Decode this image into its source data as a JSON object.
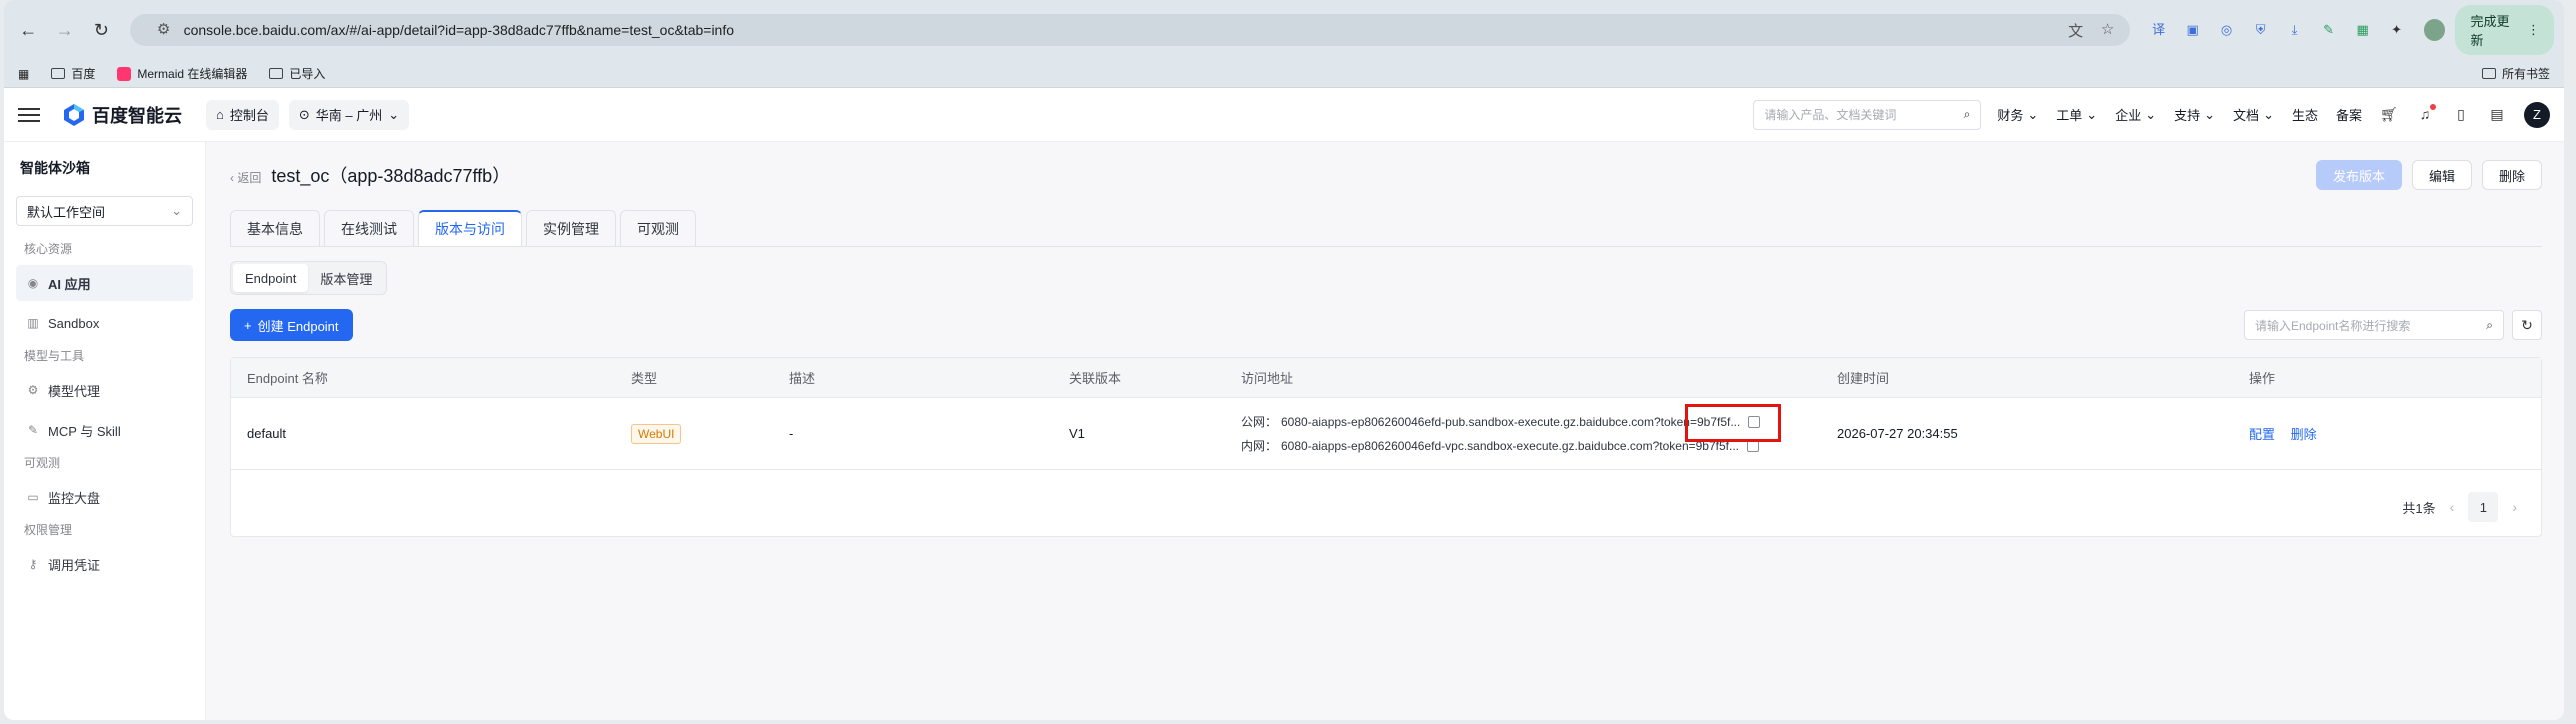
{
  "browser": {
    "url": "console.bce.baidu.com/ax/#/ai-app/detail?id=app-38d8adc77ffb&name=test_oc&tab=info",
    "update_label": "完成更新",
    "bookmarks": [
      "百度",
      "Mermaid 在线编辑器",
      "已导入"
    ],
    "all_bookmarks": "所有书签"
  },
  "topnav": {
    "brand": "百度智能云",
    "console": "控制台",
    "region": "华南 – 广州",
    "search_placeholder": "请输入产品、文档关键词",
    "menu": [
      "财务",
      "工单",
      "企业",
      "支持",
      "文档",
      "生态",
      "备案"
    ],
    "user_initial": "Z"
  },
  "sidebar": {
    "title": "智能体沙箱",
    "workspace": "默认工作空间",
    "groups": [
      {
        "label": "核心资源",
        "items": [
          "AI 应用",
          "Sandbox"
        ]
      },
      {
        "label": "模型与工具",
        "items": [
          "模型代理",
          "MCP 与 Skill"
        ]
      },
      {
        "label": "可观测",
        "items": [
          "监控大盘"
        ]
      },
      {
        "label": "权限管理",
        "items": [
          "调用凭证"
        ]
      }
    ]
  },
  "page": {
    "back": "返回",
    "title": "test_oc（app-38d8adc77ffb）",
    "actions": {
      "publish": "发布版本",
      "edit": "编辑",
      "delete": "删除"
    },
    "tabs": [
      "基本信息",
      "在线测试",
      "版本与访问",
      "实例管理",
      "可观测"
    ],
    "active_tab": "版本与访问",
    "segments": [
      "Endpoint",
      "版本管理"
    ],
    "create_label": "创建 Endpoint",
    "ep_search_placeholder": "请输入Endpoint名称进行搜索"
  },
  "table": {
    "headers": [
      "Endpoint 名称",
      "类型",
      "描述",
      "关联版本",
      "访问地址",
      "创建时间",
      "操作"
    ],
    "rows": [
      {
        "name": "default",
        "type": "WebUI",
        "desc": "-",
        "version": "V1",
        "public_label": "公网：",
        "public_url": "6080-aiapps-ep806260046efd-pub.sandbox-execute.gz.baidubce.com?token=9b7f5f...",
        "private_label": "内网：",
        "private_url": "6080-aiapps-ep806260046efd-vpc.sandbox-execute.gz.baidubce.com?token=9b7f5f...",
        "created": "2026-07-27 20:34:55",
        "op_config": "配置",
        "op_delete": "删除"
      }
    ],
    "total": "共1条",
    "page": "1"
  }
}
